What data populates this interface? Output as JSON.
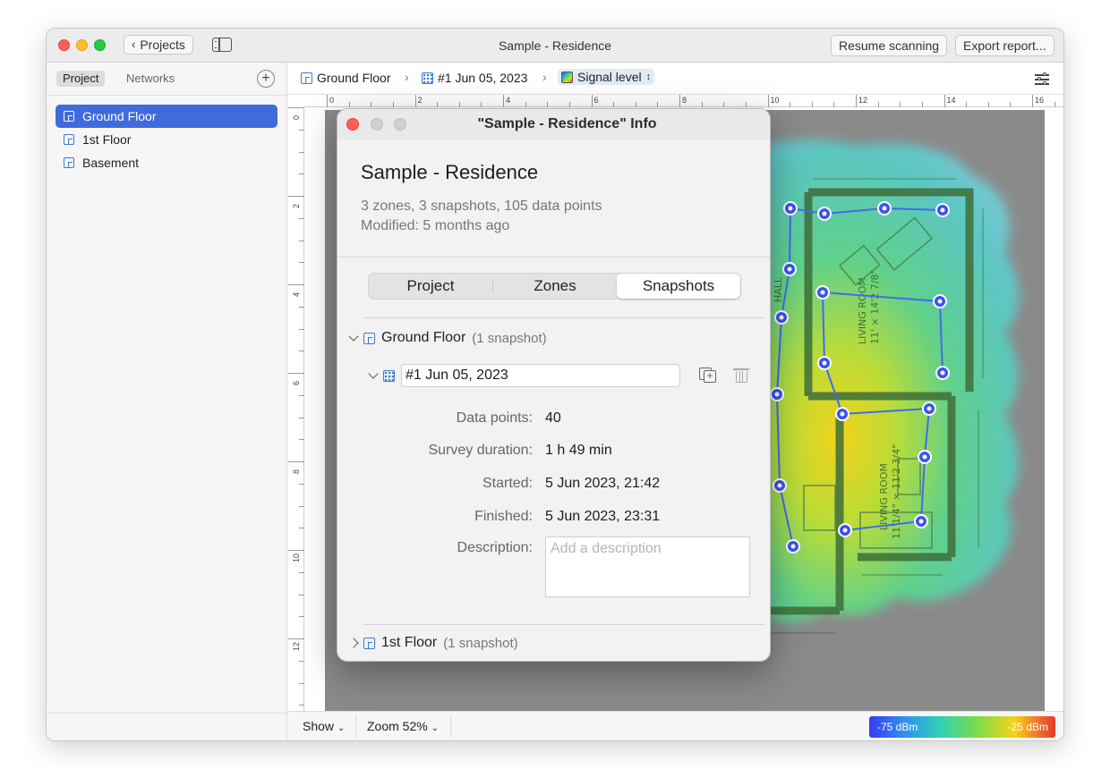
{
  "window": {
    "title": "Sample - Residence",
    "back_label": "Projects",
    "resume_label": "Resume scanning",
    "export_label": "Export report..."
  },
  "sidebar": {
    "tabs": [
      "Project",
      "Networks"
    ],
    "add_label": "+",
    "floors": [
      {
        "label": "Ground Floor",
        "selected": true
      },
      {
        "label": "1st Floor",
        "selected": false
      },
      {
        "label": "Basement",
        "selected": false
      }
    ]
  },
  "breadcrumb": {
    "floor": "Ground Floor",
    "snapshot": "#1 Jun 05, 2023",
    "layer": "Signal level"
  },
  "rulers": {
    "top_labels": [
      "0",
      "2",
      "4",
      "6",
      "8",
      "10",
      "12",
      "14",
      "16"
    ],
    "left_labels": [
      "0",
      "2",
      "4",
      "6",
      "8",
      "10",
      "12"
    ]
  },
  "bottombar": {
    "show_label": "Show",
    "zoom_label": "Zoom 52%",
    "legend_low": "-75 dBm",
    "legend_high": "-25 dBm"
  },
  "info_panel": {
    "title": "\"Sample - Residence\" Info",
    "project_name": "Sample - Residence",
    "summary": "3 zones, 3 snapshots, 105 data points",
    "modified": "Modified: 5 months ago",
    "tabs": [
      "Project",
      "Zones",
      "Snapshots"
    ],
    "active_tab": "Snapshots",
    "group1": {
      "name": "Ground Floor",
      "count": "(1 snapshot)"
    },
    "snapshot_name": "#1 Jun 05, 2023",
    "details": [
      {
        "label": "Data points:",
        "value": "40"
      },
      {
        "label": "Survey duration:",
        "value": "1 h 49 min"
      },
      {
        "label": "Started:",
        "value": "5 Jun 2023, 21:42"
      },
      {
        "label": "Finished:",
        "value": "5 Jun 2023, 23:31"
      }
    ],
    "description_label": "Description:",
    "description_placeholder": "Add a description",
    "group2": {
      "name": "1st Floor",
      "count": "(1 snapshot)"
    }
  },
  "floor_plan": {
    "room_labels": [
      "HALL",
      "LIVING ROOM",
      "11' × 14'2 7/8\"",
      "LIVING ROOM",
      "11'1/4\" × 11'2 3/4\""
    ]
  }
}
